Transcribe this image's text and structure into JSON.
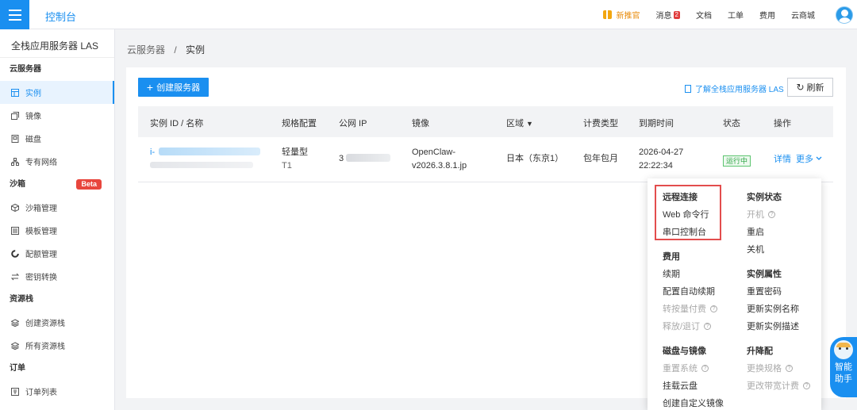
{
  "header": {
    "brand": "控制台",
    "promo": "新推官",
    "messages": "消息",
    "message_count": "2",
    "docs": "文档",
    "tickets": "工单",
    "billing": "费用",
    "mall": "云商城"
  },
  "sidebar": {
    "title": "全栈应用服务器 LAS",
    "groups": [
      {
        "label": "云服务器",
        "items": [
          "实例",
          "镜像",
          "磁盘",
          "专有网络"
        ]
      },
      {
        "label": "沙箱",
        "badge": "Beta",
        "items": [
          "沙箱管理",
          "模板管理",
          "配额管理",
          "密钥转换"
        ]
      },
      {
        "label": "资源栈",
        "items": [
          "创建资源栈",
          "所有资源栈"
        ]
      },
      {
        "label": "订单",
        "items": [
          "订单列表"
        ]
      }
    ]
  },
  "breadcrumb": {
    "parent": "云服务器",
    "sep": "/",
    "current": "实例"
  },
  "toolbar": {
    "create_label": "创建服务器",
    "learn_link": "了解全栈应用服务器 LAS",
    "refresh_label": "刷新"
  },
  "table": {
    "columns": [
      "实例 ID / 名称",
      "规格配置",
      "公网 IP",
      "镜像",
      "区域",
      "计费类型",
      "到期时间",
      "状态",
      "操作"
    ],
    "rows": [
      {
        "id_prefix": "i-",
        "spec_type": "轻量型",
        "spec_size": "T1",
        "ip_prefix": "3",
        "image_line1": "OpenClaw-",
        "image_line2": "v2026.3.8.1.jp",
        "region": "日本（东京1）",
        "billing": "包年包月",
        "expire_date": "2026-04-27",
        "expire_time": "22:22:34",
        "status": "运行中",
        "op_detail": "详情",
        "op_more": "更多"
      }
    ]
  },
  "more_menu": {
    "remote": {
      "title": "远程连接",
      "items": [
        "Web 命令行",
        "串口控制台"
      ]
    },
    "state": {
      "title": "实例状态",
      "items": [
        "开机",
        "重启",
        "关机"
      ]
    },
    "fee": {
      "title": "费用",
      "items": [
        "续期",
        "配置自动续期",
        "转按量付费",
        "释放/退订"
      ]
    },
    "attr": {
      "title": "实例属性",
      "items": [
        "重置密码",
        "更新实例名称",
        "更新实例描述"
      ]
    },
    "disk": {
      "title": "磁盘与镜像",
      "items": [
        "重置系统",
        "挂载云盘",
        "创建自定义镜像"
      ]
    },
    "upgrade": {
      "title": "升降配",
      "items": [
        "更换规格",
        "更改带宽计费"
      ]
    },
    "help_glyph": "?"
  },
  "assistant": {
    "line1": "智能",
    "line2": "助手"
  },
  "colors": {
    "accent": "#1a8ff0",
    "highlight_border": "#e34d4d",
    "running": "#2da544",
    "beta": "#e8463d"
  }
}
